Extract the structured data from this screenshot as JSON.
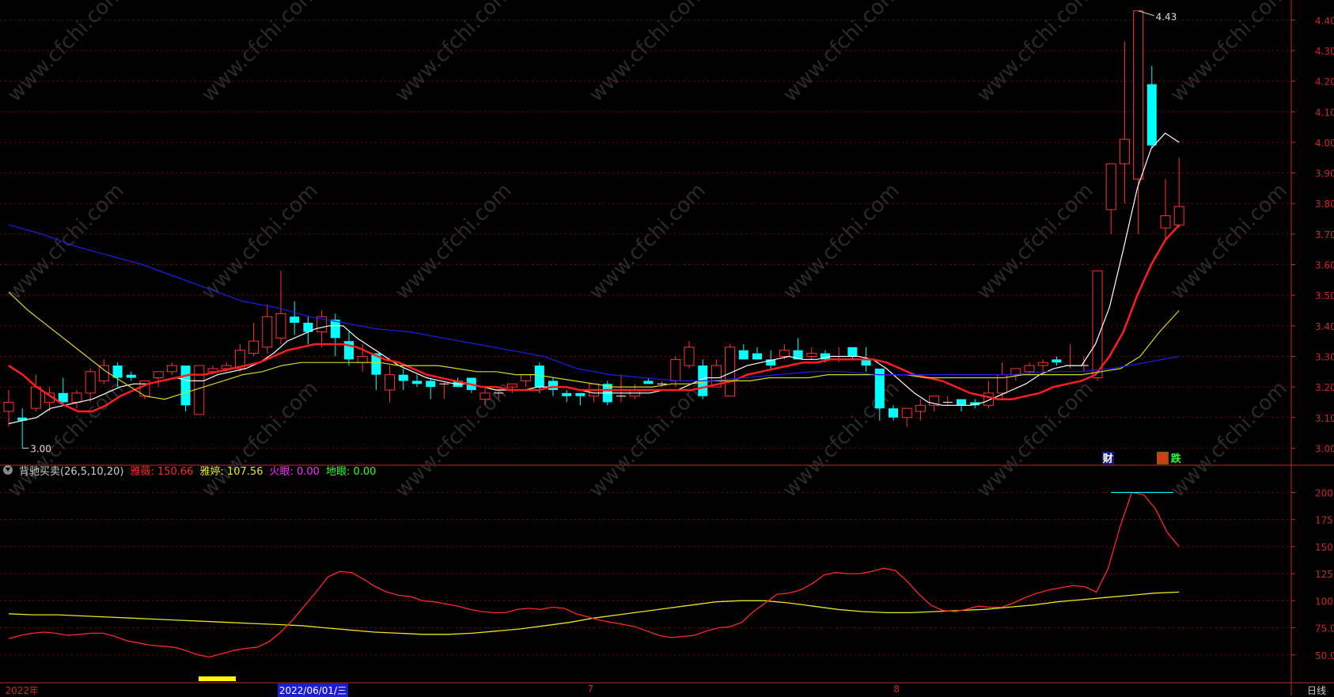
{
  "chart_data": {
    "type": "candlestick",
    "price_axis": {
      "ticks": [
        "4.40",
        "4.30",
        "4.20",
        "4.10",
        "4.00",
        "3.90",
        "3.80",
        "3.70",
        "3.60",
        "3.50",
        "3.40",
        "3.30",
        "3.20",
        "3.10",
        "3.00"
      ],
      "range": [
        2.97,
        4.45
      ]
    },
    "candles": [
      {
        "o": 3.12,
        "h": 3.19,
        "l": 3.07,
        "c": 3.15
      },
      {
        "o": 3.1,
        "h": 3.13,
        "l": 3.0,
        "c": 3.09
      },
      {
        "o": 3.13,
        "h": 3.24,
        "l": 3.12,
        "c": 3.2
      },
      {
        "o": 3.15,
        "h": 3.2,
        "l": 3.12,
        "c": 3.18
      },
      {
        "o": 3.18,
        "h": 3.23,
        "l": 3.14,
        "c": 3.15
      },
      {
        "o": 3.15,
        "h": 3.19,
        "l": 3.13,
        "c": 3.18
      },
      {
        "o": 3.18,
        "h": 3.26,
        "l": 3.15,
        "c": 3.25
      },
      {
        "o": 3.22,
        "h": 3.29,
        "l": 3.21,
        "c": 3.27
      },
      {
        "o": 3.27,
        "h": 3.28,
        "l": 3.2,
        "c": 3.23
      },
      {
        "o": 3.24,
        "h": 3.25,
        "l": 3.22,
        "c": 3.23
      },
      {
        "o": 3.17,
        "h": 3.22,
        "l": 3.16,
        "c": 3.22
      },
      {
        "o": 3.23,
        "h": 3.25,
        "l": 3.2,
        "c": 3.25
      },
      {
        "o": 3.25,
        "h": 3.28,
        "l": 3.24,
        "c": 3.27
      },
      {
        "o": 3.27,
        "h": 3.27,
        "l": 3.12,
        "c": 3.14
      },
      {
        "o": 3.11,
        "h": 3.27,
        "l": 3.11,
        "c": 3.27
      },
      {
        "o": 3.25,
        "h": 3.27,
        "l": 3.24,
        "c": 3.26
      },
      {
        "o": 3.26,
        "h": 3.28,
        "l": 3.25,
        "c": 3.27
      },
      {
        "o": 3.26,
        "h": 3.34,
        "l": 3.25,
        "c": 3.32
      },
      {
        "o": 3.31,
        "h": 3.41,
        "l": 3.3,
        "c": 3.35
      },
      {
        "o": 3.33,
        "h": 3.47,
        "l": 3.31,
        "c": 3.43
      },
      {
        "o": 3.36,
        "h": 3.58,
        "l": 3.34,
        "c": 3.44
      },
      {
        "o": 3.43,
        "h": 3.48,
        "l": 3.37,
        "c": 3.41
      },
      {
        "o": 3.41,
        "h": 3.43,
        "l": 3.34,
        "c": 3.38
      },
      {
        "o": 3.38,
        "h": 3.45,
        "l": 3.33,
        "c": 3.43
      },
      {
        "o": 3.42,
        "h": 3.44,
        "l": 3.3,
        "c": 3.36
      },
      {
        "o": 3.35,
        "h": 3.38,
        "l": 3.27,
        "c": 3.29
      },
      {
        "o": 3.28,
        "h": 3.34,
        "l": 3.25,
        "c": 3.3
      },
      {
        "o": 3.31,
        "h": 3.31,
        "l": 3.19,
        "c": 3.24
      },
      {
        "o": 3.19,
        "h": 3.27,
        "l": 3.15,
        "c": 3.24
      },
      {
        "o": 3.24,
        "h": 3.26,
        "l": 3.19,
        "c": 3.22
      },
      {
        "o": 3.22,
        "h": 3.24,
        "l": 3.2,
        "c": 3.21
      },
      {
        "o": 3.22,
        "h": 3.23,
        "l": 3.16,
        "c": 3.2
      },
      {
        "o": 3.21,
        "h": 3.22,
        "l": 3.16,
        "c": 3.21
      },
      {
        "o": 3.22,
        "h": 3.23,
        "l": 3.2,
        "c": 3.2
      },
      {
        "o": 3.23,
        "h": 3.23,
        "l": 3.18,
        "c": 3.19
      },
      {
        "o": 3.16,
        "h": 3.2,
        "l": 3.14,
        "c": 3.18
      },
      {
        "o": 3.18,
        "h": 3.19,
        "l": 3.16,
        "c": 3.18
      },
      {
        "o": 3.2,
        "h": 3.21,
        "l": 3.18,
        "c": 3.21
      },
      {
        "o": 3.22,
        "h": 3.24,
        "l": 3.2,
        "c": 3.24
      },
      {
        "o": 3.27,
        "h": 3.28,
        "l": 3.18,
        "c": 3.2
      },
      {
        "o": 3.22,
        "h": 3.23,
        "l": 3.17,
        "c": 3.19
      },
      {
        "o": 3.18,
        "h": 3.19,
        "l": 3.15,
        "c": 3.17
      },
      {
        "o": 3.18,
        "h": 3.18,
        "l": 3.14,
        "c": 3.17
      },
      {
        "o": 3.17,
        "h": 3.21,
        "l": 3.15,
        "c": 3.21
      },
      {
        "o": 3.21,
        "h": 3.22,
        "l": 3.14,
        "c": 3.15
      },
      {
        "o": 3.17,
        "h": 3.24,
        "l": 3.15,
        "c": 3.17
      },
      {
        "o": 3.17,
        "h": 3.21,
        "l": 3.16,
        "c": 3.19
      },
      {
        "o": 3.22,
        "h": 3.23,
        "l": 3.21,
        "c": 3.21
      },
      {
        "o": 3.21,
        "h": 3.22,
        "l": 3.2,
        "c": 3.21
      },
      {
        "o": 3.22,
        "h": 3.3,
        "l": 3.2,
        "c": 3.29
      },
      {
        "o": 3.27,
        "h": 3.35,
        "l": 3.26,
        "c": 3.33
      },
      {
        "o": 3.27,
        "h": 3.29,
        "l": 3.16,
        "c": 3.17
      },
      {
        "o": 3.2,
        "h": 3.29,
        "l": 3.2,
        "c": 3.27
      },
      {
        "o": 3.17,
        "h": 3.34,
        "l": 3.17,
        "c": 3.33
      },
      {
        "o": 3.32,
        "h": 3.34,
        "l": 3.29,
        "c": 3.29
      },
      {
        "o": 3.31,
        "h": 3.33,
        "l": 3.29,
        "c": 3.29
      },
      {
        "o": 3.29,
        "h": 3.32,
        "l": 3.26,
        "c": 3.27
      },
      {
        "o": 3.3,
        "h": 3.34,
        "l": 3.29,
        "c": 3.32
      },
      {
        "o": 3.32,
        "h": 3.36,
        "l": 3.29,
        "c": 3.29
      },
      {
        "o": 3.3,
        "h": 3.33,
        "l": 3.29,
        "c": 3.31
      },
      {
        "o": 3.31,
        "h": 3.32,
        "l": 3.28,
        "c": 3.29
      },
      {
        "o": 3.29,
        "h": 3.33,
        "l": 3.28,
        "c": 3.29
      },
      {
        "o": 3.33,
        "h": 3.33,
        "l": 3.29,
        "c": 3.3
      },
      {
        "o": 3.29,
        "h": 3.33,
        "l": 3.25,
        "c": 3.27
      },
      {
        "o": 3.26,
        "h": 3.26,
        "l": 3.09,
        "c": 3.13
      },
      {
        "o": 3.13,
        "h": 3.14,
        "l": 3.09,
        "c": 3.1
      },
      {
        "o": 3.1,
        "h": 3.13,
        "l": 3.07,
        "c": 3.13
      },
      {
        "o": 3.12,
        "h": 3.16,
        "l": 3.09,
        "c": 3.14
      },
      {
        "o": 3.14,
        "h": 3.17,
        "l": 3.12,
        "c": 3.17
      },
      {
        "o": 3.15,
        "h": 3.17,
        "l": 3.14,
        "c": 3.15
      },
      {
        "o": 3.16,
        "h": 3.16,
        "l": 3.12,
        "c": 3.14
      },
      {
        "o": 3.15,
        "h": 3.16,
        "l": 3.13,
        "c": 3.14
      },
      {
        "o": 3.14,
        "h": 3.22,
        "l": 3.13,
        "c": 3.18
      },
      {
        "o": 3.18,
        "h": 3.28,
        "l": 3.16,
        "c": 3.24
      },
      {
        "o": 3.24,
        "h": 3.26,
        "l": 3.22,
        "c": 3.26
      },
      {
        "o": 3.25,
        "h": 3.28,
        "l": 3.24,
        "c": 3.27
      },
      {
        "o": 3.27,
        "h": 3.29,
        "l": 3.25,
        "c": 3.28
      },
      {
        "o": 3.29,
        "h": 3.3,
        "l": 3.27,
        "c": 3.28
      },
      {
        "o": 3.27,
        "h": 3.34,
        "l": 3.26,
        "c": 3.27
      },
      {
        "o": 3.27,
        "h": 3.3,
        "l": 3.25,
        "c": 3.27
      },
      {
        "o": 3.23,
        "h": 3.58,
        "l": 3.22,
        "c": 3.58
      },
      {
        "o": 3.78,
        "h": 3.93,
        "l": 3.7,
        "c": 3.93
      },
      {
        "o": 3.93,
        "h": 4.33,
        "l": 3.8,
        "c": 4.01
      },
      {
        "o": 3.88,
        "h": 4.43,
        "l": 3.7,
        "c": 4.43
      },
      {
        "o": 4.19,
        "h": 4.25,
        "l": 3.98,
        "c": 3.99
      },
      {
        "o": 3.72,
        "h": 3.88,
        "l": 3.68,
        "c": 3.76
      },
      {
        "o": 3.73,
        "h": 3.95,
        "l": 3.72,
        "c": 3.79
      }
    ],
    "high_label": "4.43",
    "low_label": "3.00",
    "ma_lines": [
      {
        "color": "#ffffff",
        "values": [
          3.08,
          3.09,
          3.1,
          3.13,
          3.14,
          3.15,
          3.16,
          3.18,
          3.2,
          3.21,
          3.21,
          3.22,
          3.23,
          3.22,
          3.22,
          3.24,
          3.25,
          3.26,
          3.28,
          3.31,
          3.35,
          3.37,
          3.39,
          3.4,
          3.4,
          3.36,
          3.33,
          3.3,
          3.27,
          3.25,
          3.23,
          3.22,
          3.21,
          3.21,
          3.2,
          3.19,
          3.19,
          3.19,
          3.2,
          3.2,
          3.2,
          3.19,
          3.18,
          3.18,
          3.18,
          3.18,
          3.18,
          3.19,
          3.19,
          3.21,
          3.23,
          3.23,
          3.25,
          3.27,
          3.28,
          3.29,
          3.3,
          3.29,
          3.29,
          3.3,
          3.3,
          3.3,
          3.29,
          3.26,
          3.22,
          3.18,
          3.15,
          3.14,
          3.14,
          3.14,
          3.15,
          3.17,
          3.19,
          3.21,
          3.24,
          3.26,
          3.27,
          3.27,
          3.34,
          3.46,
          3.65,
          3.85,
          3.98,
          4.03,
          4.0
        ]
      },
      {
        "color": "#ff1e1e",
        "values": [
          3.27,
          3.24,
          3.2,
          3.17,
          3.14,
          3.12,
          3.12,
          3.14,
          3.17,
          3.19,
          3.21,
          3.22,
          3.23,
          3.24,
          3.24,
          3.25,
          3.26,
          3.27,
          3.28,
          3.3,
          3.32,
          3.33,
          3.34,
          3.34,
          3.34,
          3.33,
          3.31,
          3.29,
          3.28,
          3.26,
          3.24,
          3.23,
          3.22,
          3.21,
          3.2,
          3.2,
          3.19,
          3.19,
          3.19,
          3.2,
          3.2,
          3.19,
          3.19,
          3.19,
          3.19,
          3.19,
          3.19,
          3.19,
          3.19,
          3.19,
          3.2,
          3.21,
          3.22,
          3.24,
          3.25,
          3.26,
          3.27,
          3.28,
          3.28,
          3.29,
          3.29,
          3.29,
          3.29,
          3.28,
          3.26,
          3.24,
          3.23,
          3.22,
          3.2,
          3.18,
          3.17,
          3.16,
          3.16,
          3.17,
          3.18,
          3.2,
          3.21,
          3.22,
          3.24,
          3.3,
          3.38,
          3.5,
          3.6,
          3.68,
          3.73
        ]
      },
      {
        "color": "#d7d71e",
        "values": [
          3.51,
          3.45,
          3.4,
          3.35,
          3.3,
          3.25,
          3.21,
          3.17,
          3.16,
          3.18,
          3.2,
          3.22,
          3.24,
          3.25,
          3.27,
          3.28,
          3.28,
          3.28,
          3.28,
          3.28,
          3.27,
          3.27,
          3.27,
          3.26,
          3.25,
          3.25,
          3.24,
          3.24,
          3.23,
          3.22,
          3.21,
          3.2,
          3.2,
          3.2,
          3.21,
          3.21,
          3.22,
          3.22,
          3.22,
          3.23,
          3.23,
          3.23,
          3.24,
          3.24,
          3.24,
          3.24,
          3.24,
          3.23,
          3.23,
          3.23,
          3.23,
          3.23,
          3.24,
          3.24,
          3.24,
          3.24,
          3.25,
          3.26,
          3.3,
          3.38,
          3.45
        ]
      },
      {
        "color": "#1e1ee6",
        "values": [
          3.73,
          3.7,
          3.66,
          3.63,
          3.6,
          3.56,
          3.52,
          3.48,
          3.46,
          3.43,
          3.41,
          3.39,
          3.38,
          3.36,
          3.34,
          3.32,
          3.3,
          3.26,
          3.24,
          3.23,
          3.22,
          3.22,
          3.23,
          3.24,
          3.25,
          3.25,
          3.24,
          3.24,
          3.24,
          3.24,
          3.24,
          3.25,
          3.25,
          3.26,
          3.28,
          3.3
        ]
      }
    ],
    "event_tags": [
      {
        "text": "财",
        "color": "#ffffff",
        "bg": "#1c1c80",
        "candle": 81
      },
      {
        "text": "榜",
        "color": "#ff2828",
        "bg": "#806000",
        "candle": 85
      },
      {
        "text": "跌",
        "color": "#28ff28",
        "bg": "",
        "candle": 86
      }
    ],
    "indicator": {
      "name": "背驰买卖(26,5,10,20)",
      "fields": [
        {
          "label": "雅薇:",
          "value": "150.66",
          "color": "#ff2828"
        },
        {
          "label": "雅婷:",
          "value": "107.56",
          "color": "#e6e61e"
        },
        {
          "label": "火眼:",
          "value": "0.00",
          "color": "#ff28ff"
        },
        {
          "label": "地眼:",
          "value": "0.00",
          "color": "#28ff28"
        }
      ],
      "axis_ticks": [
        "200.0",
        "175.0",
        "150.0",
        "125.0",
        "100.0",
        "75.0",
        "50.0"
      ],
      "range": [
        25,
        212
      ],
      "red_line": [
        65,
        68,
        70,
        71,
        70,
        68,
        69,
        70,
        70,
        67,
        63,
        61,
        59,
        58,
        57,
        54,
        50,
        48,
        51,
        54,
        56,
        57,
        62,
        71,
        82,
        95,
        108,
        122,
        127,
        126,
        120,
        113,
        108,
        105,
        104,
        100,
        99,
        97,
        95,
        92,
        90,
        89,
        89,
        92,
        93,
        92,
        94,
        93,
        88,
        85,
        82,
        80,
        78,
        76,
        72,
        68,
        66,
        67,
        68,
        72,
        75,
        76,
        80,
        90,
        98,
        106,
        107,
        110,
        116,
        124,
        126,
        125,
        125,
        127,
        130,
        128,
        118,
        106,
        96,
        91,
        90,
        92,
        95,
        94,
        94,
        98,
        103,
        107,
        110,
        112,
        114,
        113,
        108,
        130,
        168,
        200,
        198,
        185,
        163,
        150
      ],
      "yellow_line": [
        88,
        87,
        87,
        86,
        85,
        84,
        83,
        82,
        81,
        80,
        79,
        78,
        77,
        75,
        73,
        71,
        70,
        69,
        69,
        70,
        72,
        74,
        77,
        80,
        84,
        87,
        90,
        93,
        96,
        99,
        100,
        100,
        98,
        95,
        92,
        90,
        89,
        89,
        90,
        91,
        92,
        94,
        96,
        99,
        101,
        103,
        105,
        107,
        108
      ],
      "top_line_value": 200
    },
    "dates": [
      {
        "text": "2022年",
        "pos": 0.004,
        "highlight": false
      },
      {
        "text": "2022/06/01/三",
        "pos": 0.215,
        "highlight": true
      },
      {
        "text": "7",
        "pos": 0.455,
        "highlight": false
      },
      {
        "text": "8",
        "pos": 0.692,
        "highlight": false
      }
    ],
    "period": "日线",
    "watermark": "www.cfchi.com",
    "colors": {
      "up": "#ff3232",
      "down": "#00ffff",
      "grid": "#8c0000",
      "axis": "#c82828"
    }
  }
}
